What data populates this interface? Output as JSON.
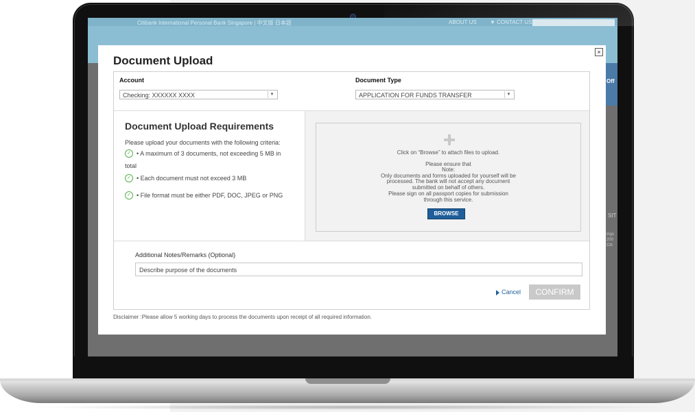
{
  "website": {
    "title": "Citibank International Personal Bank Singapore | 中文版 日本語",
    "nav_about": "ABOUT US",
    "nav_contact": "▼ CONTACT US",
    "side_off": "Off",
    "side_sit": "SIT",
    "side_mini": "ings\n200\nCiti"
  },
  "modal": {
    "close_label": "×",
    "title": "Document Upload",
    "account": {
      "label": "Account",
      "selected": "Checking: XXXXXX XXXX",
      "arrow": "▼"
    },
    "document_type": {
      "label": "Document Type",
      "selected": "APPLICATION FOR FUNDS TRANSFER",
      "arrow": "▼"
    },
    "requirements": {
      "title": "Document Upload Requirements",
      "intro": "Please upload your documents with the following criteria:",
      "items": [
        {
          "line1": "• A maximum of 3 documents, not exceeding 5 MB in",
          "line2": "total"
        },
        {
          "line1": "• Each document must not exceed 3 MB"
        },
        {
          "line1": "• File format must be either PDF, DOC, JPEG or PNG"
        }
      ]
    },
    "upload": {
      "instruction": "Click on “Browse” to attach files to upload.",
      "ensure": "Please ensure that",
      "note_title": "Note:",
      "note_lines": [
        "Only documents and forms uploaded for yourself will be",
        "processed. The bank will not accept any document",
        "submitted on behalf of others.",
        "Please sign on all passport copies for submission",
        "through this service."
      ],
      "browse_label": "BROWSE"
    },
    "notes": {
      "label": "Additional Notes/Remarks (Optional)",
      "placeholder": "Describe purpose of the documents"
    },
    "cancel_label": "Cancel",
    "confirm_label": "CONFIRM",
    "disclaimer": "Disclaimer :Please allow 5 working days to process the documents upon receipt of all required information."
  },
  "colors": {
    "accent": "#1f5e9a",
    "check": "#56b04a",
    "confirm_disabled": "#c9c9c9"
  }
}
